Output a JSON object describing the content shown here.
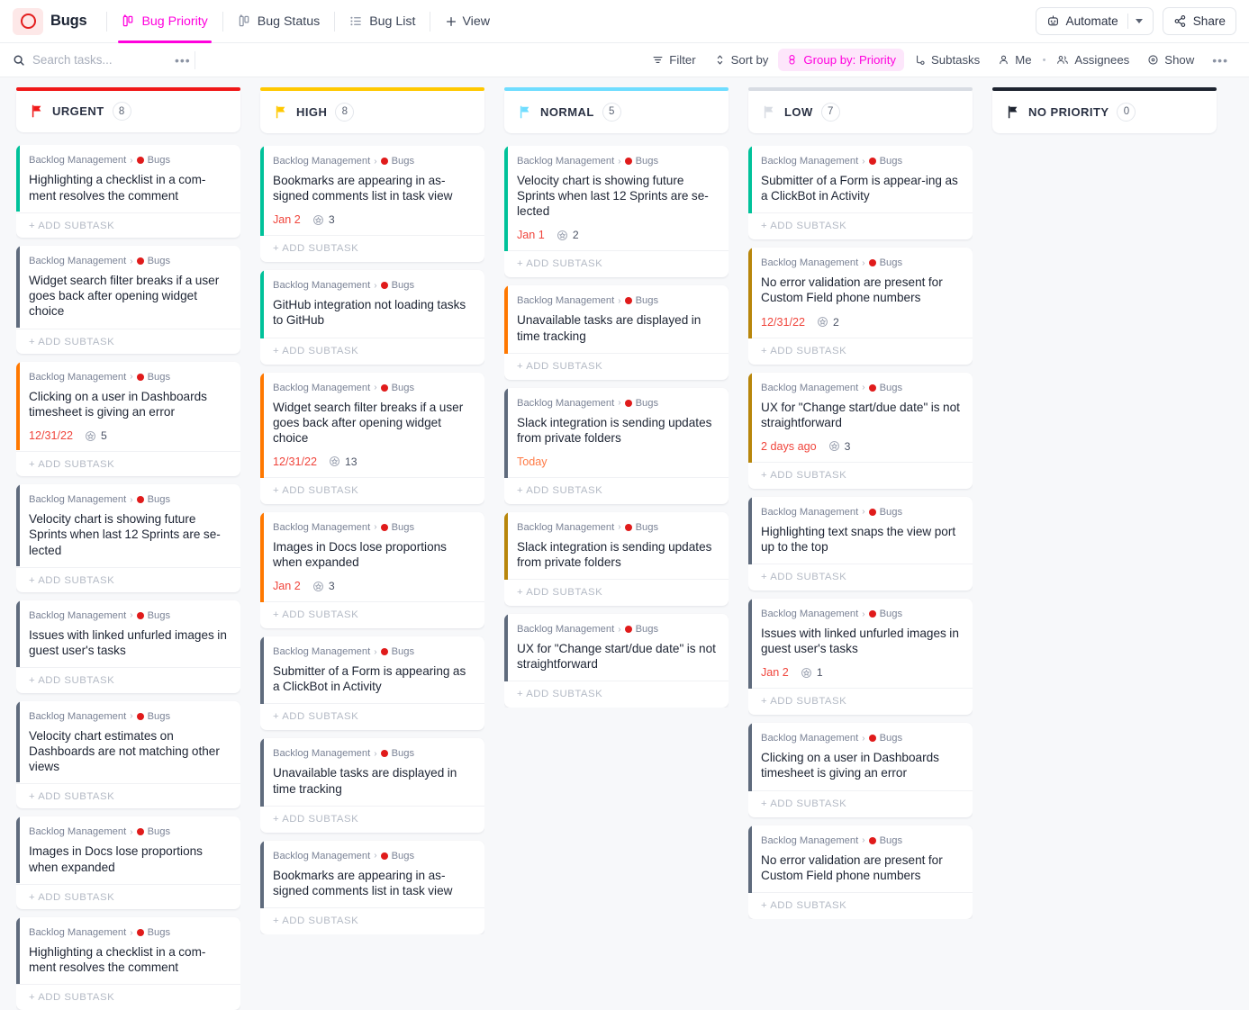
{
  "header": {
    "space_name": "Bugs",
    "logo_icon": "clickup-ring-logo",
    "tabs": [
      {
        "label": "Bug Priority",
        "icon": "board-view-icon",
        "active": true
      },
      {
        "label": "Bug Status",
        "icon": "board-view-icon",
        "active": false
      },
      {
        "label": "Bug List",
        "icon": "list-view-icon",
        "active": false
      }
    ],
    "add_view_label": "View",
    "automate_label": "Automate",
    "share_label": "Share",
    "automate_icon": "robot-icon",
    "share_icon": "share-nodes-icon"
  },
  "toolbar": {
    "search_placeholder": "Search tasks...",
    "search_value": "",
    "search_icon": "search-icon",
    "more_icon": "ellipsis-icon",
    "buttons": [
      {
        "label": "Filter",
        "icon": "filter-icon",
        "active": false
      },
      {
        "label": "Sort by",
        "icon": "sort-icon",
        "active": false
      },
      {
        "label": "Group by: Priority",
        "icon": "group-by-icon",
        "active": true
      },
      {
        "label": "Subtasks",
        "icon": "subtasks-icon",
        "active": false
      },
      {
        "label": "Me",
        "icon": "person-icon",
        "active": false
      },
      {
        "label": "Assignees",
        "icon": "people-icon",
        "active": false
      },
      {
        "label": "Show",
        "icon": "eye-circle-icon",
        "active": false
      }
    ],
    "overflow_icon": "ellipsis-icon"
  },
  "colors": {
    "accent": "#ff00dd",
    "urgent": "#f01818",
    "high": "#ffc800",
    "normal": "#6fddff",
    "low": "#d8dce3",
    "no_priority": "#1e2430",
    "bar_teal": "#00c29a",
    "bar_orange": "#ff7800",
    "bar_slate": "#5f6b7d",
    "bar_gold": "#b8860b",
    "due_red": "#f0453c",
    "due_orange": "#ff7a45"
  },
  "add_subtask_label": "+ ADD SUBTASK",
  "crumb": {
    "folder": "Backlog Management",
    "list": "Bugs"
  },
  "columns": [
    {
      "name": "URGENT",
      "count": "8",
      "accent": "#f01818",
      "flag": "urgent-flag-icon",
      "cards": [
        {
          "title": "Highlighting a checklist in a com-ment resolves the comment",
          "bar": "#00c29a",
          "due": null,
          "due_tone": null,
          "subtasks": null
        },
        {
          "title": "Widget search filter breaks if a user goes back after opening widget choice",
          "bar": "#5f6b7d",
          "due": null,
          "due_tone": null,
          "subtasks": null
        },
        {
          "title": "Clicking on a user in Dashboards timesheet is giving an error",
          "bar": "#ff7800",
          "due": "12/31/22",
          "due_tone": "red",
          "subtasks": "5"
        },
        {
          "title": "Velocity chart is showing future Sprints when last 12 Sprints are se-lected",
          "bar": "#5f6b7d",
          "due": null,
          "due_tone": null,
          "subtasks": null
        },
        {
          "title": "Issues with linked unfurled images in guest user's tasks",
          "bar": "#5f6b7d",
          "due": null,
          "due_tone": null,
          "subtasks": null
        },
        {
          "title": "Velocity chart estimates on Dashboards are not matching other views",
          "bar": "#5f6b7d",
          "due": null,
          "due_tone": null,
          "subtasks": null
        },
        {
          "title": "Images in Docs lose proportions when expanded",
          "bar": "#5f6b7d",
          "due": null,
          "due_tone": null,
          "subtasks": null
        },
        {
          "title": "Highlighting a checklist in a com-ment resolves the comment",
          "bar": "#5f6b7d",
          "due": null,
          "due_tone": null,
          "subtasks": null
        }
      ]
    },
    {
      "name": "HIGH",
      "count": "8",
      "accent": "#ffc800",
      "flag": "high-flag-icon",
      "cards": [
        {
          "title": "Bookmarks are appearing in as-signed comments list in task view",
          "bar": "#00c29a",
          "due": "Jan 2",
          "due_tone": "red",
          "subtasks": "3"
        },
        {
          "title": "GitHub integration not loading tasks to GitHub",
          "bar": "#00c29a",
          "due": null,
          "due_tone": null,
          "subtasks": null
        },
        {
          "title": "Widget search filter breaks if a user goes back after opening widget choice",
          "bar": "#ff7800",
          "due": "12/31/22",
          "due_tone": "red",
          "subtasks": "13"
        },
        {
          "title": "Images in Docs lose proportions when expanded",
          "bar": "#ff7800",
          "due": "Jan 2",
          "due_tone": "red",
          "subtasks": "3"
        },
        {
          "title": "Submitter of a Form is appearing as a ClickBot in Activity",
          "bar": "#5f6b7d",
          "due": null,
          "due_tone": null,
          "subtasks": null
        },
        {
          "title": "Unavailable tasks are displayed in time tracking",
          "bar": "#5f6b7d",
          "due": null,
          "due_tone": null,
          "subtasks": null
        },
        {
          "title": "Bookmarks are appearing in as-signed comments list in task view",
          "bar": "#5f6b7d",
          "due": null,
          "due_tone": null,
          "subtasks": null
        }
      ]
    },
    {
      "name": "NORMAL",
      "count": "5",
      "accent": "#6fddff",
      "flag": "normal-flag-icon",
      "cards": [
        {
          "title": "Velocity chart is showing future Sprints when last 12 Sprints are se-lected",
          "bar": "#00c29a",
          "due": "Jan 1",
          "due_tone": "red",
          "subtasks": "2"
        },
        {
          "title": "Unavailable tasks are displayed in time tracking",
          "bar": "#ff7800",
          "due": null,
          "due_tone": null,
          "subtasks": null
        },
        {
          "title": "Slack integration is sending updates from private folders",
          "bar": "#5f6b7d",
          "due": "Today",
          "due_tone": "orange",
          "subtasks": null
        },
        {
          "title": "Slack integration is sending updates from private folders",
          "bar": "#b8860b",
          "due": null,
          "due_tone": null,
          "subtasks": null
        },
        {
          "title": "UX for \"Change start/due date\" is not straightforward",
          "bar": "#5f6b7d",
          "due": null,
          "due_tone": null,
          "subtasks": null
        }
      ]
    },
    {
      "name": "LOW",
      "count": "7",
      "accent": "#d8dce3",
      "flag": "low-flag-icon",
      "cards": [
        {
          "title": "Submitter of a Form is appear-ing as a ClickBot in Activity",
          "bar": "#00c29a",
          "due": null,
          "due_tone": null,
          "subtasks": null
        },
        {
          "title": "No error validation are present for Custom Field phone numbers",
          "bar": "#b8860b",
          "due": "12/31/22",
          "due_tone": "red",
          "subtasks": "2"
        },
        {
          "title": "UX for \"Change start/due date\" is not straightforward",
          "bar": "#b8860b",
          "due": "2 days ago",
          "due_tone": "red",
          "subtasks": "3"
        },
        {
          "title": "Highlighting text snaps the view port up to the top",
          "bar": "#5f6b7d",
          "due": null,
          "due_tone": null,
          "subtasks": null
        },
        {
          "title": "Issues with linked unfurled images in guest user's tasks",
          "bar": "#5f6b7d",
          "due": "Jan 2",
          "due_tone": "red",
          "subtasks": "1"
        },
        {
          "title": "Clicking on a user in Dashboards timesheet is giving an error",
          "bar": "#5f6b7d",
          "due": null,
          "due_tone": null,
          "subtasks": null
        },
        {
          "title": "No error validation are present for Custom Field phone numbers",
          "bar": "#5f6b7d",
          "due": null,
          "due_tone": null,
          "subtasks": null
        }
      ]
    },
    {
      "name": "NO PRIORITY",
      "count": "0",
      "accent": "#1e2430",
      "flag": "no-priority-flag-icon",
      "cards": []
    }
  ]
}
